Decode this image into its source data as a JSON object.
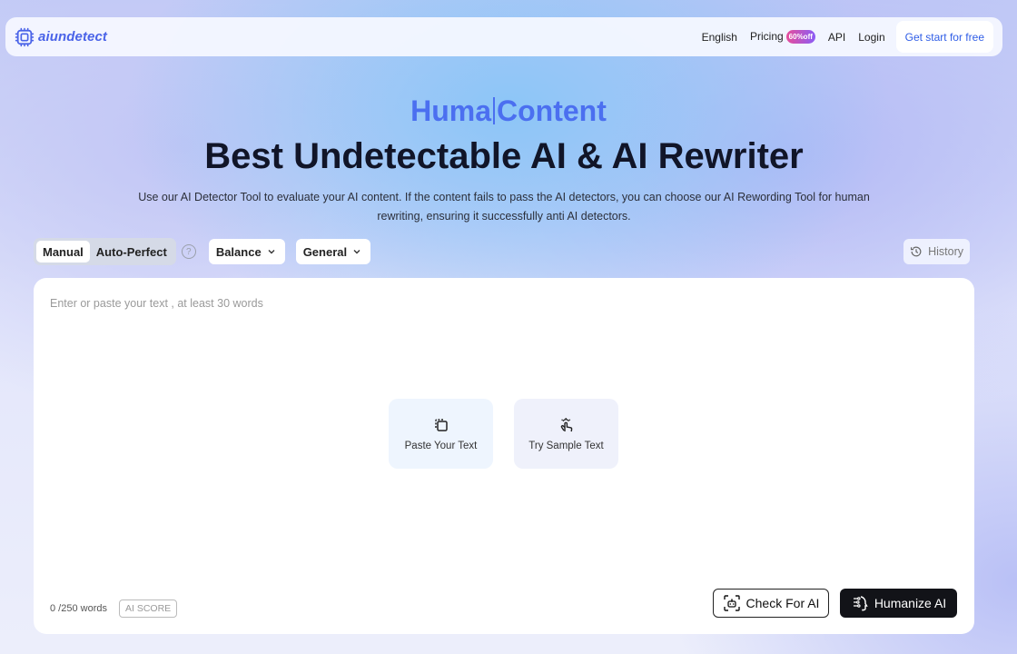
{
  "brand": {
    "name": "aiundetect"
  },
  "nav": {
    "links": [
      "English",
      "Pricing",
      "API",
      "Login"
    ],
    "pricing_badge": "60%off",
    "cta": "Get start for free"
  },
  "hero": {
    "typed_before_caret": "Huma",
    "typed_after_caret": "Content",
    "title": "Best Undetectable AI & AI Rewriter",
    "description": "Use our AI Detector Tool to evaluate your AI content. If the content fails to pass the AI detectors, you can choose our AI Rewording Tool for human rewriting, ensuring it successfully anti AI detectors."
  },
  "controls": {
    "modes": [
      "Manual",
      "Auto-Perfect"
    ],
    "active_mode": "Manual",
    "help_glyph": "?",
    "mode_select": "Balance",
    "purpose_select": "General",
    "history_label": "History"
  },
  "editor": {
    "placeholder": "Enter or paste your text , at least 30 words",
    "paste_label": "Paste Your Text",
    "sample_label": "Try Sample Text",
    "word_count": "0 /250 words",
    "ai_score_label": "AI SCORE",
    "check_button": "Check For AI",
    "humanize_button": "Humanize AI"
  },
  "icons": {
    "logo": "chip-logo-icon",
    "help": "help-circle-icon",
    "chevron": "chevron-down-icon",
    "history": "history-icon",
    "paste": "clipboard-icon",
    "sample": "tap-hand-icon",
    "check": "scan-robot-icon",
    "humanize": "human-ai-icon"
  },
  "colors": {
    "accent": "#4b6ff0",
    "brand": "#4a63e8",
    "cta_text": "#2f5de6",
    "dark_button": "#121318",
    "badge_start": "#e64d9b",
    "badge_end": "#8b5cf6"
  }
}
